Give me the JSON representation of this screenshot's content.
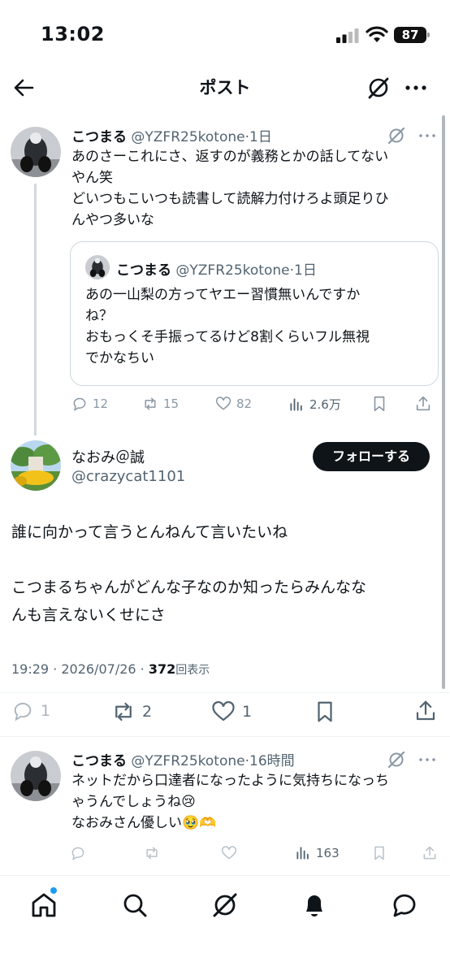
{
  "status_bar": {
    "time": "13:02",
    "battery": "87"
  },
  "header": {
    "title": "ポスト"
  },
  "tweet1": {
    "name": "こつまる",
    "handle": "@YZFR25kotone",
    "time": "1日",
    "lines": [
      "あのさーこれにさ、返すのが義務とかの話してない",
      "やん笑",
      "どいつもこいつも読書して読解力付けろよ頭足りひ",
      "んやつ多いな"
    ],
    "quote": {
      "name": "こつまる",
      "handle": "@YZFR25kotone",
      "time": "1日",
      "lines": [
        "あの一山梨の方ってヤエー習慣無いんですか",
        "ね？",
        "おもっくそ手振ってるけど8割くらいフル無視",
        "でかなちい"
      ]
    },
    "replies": "12",
    "retweets": "15",
    "likes": "82",
    "views": "2.6万"
  },
  "tweet2": {
    "name": "なおみ＠誠",
    "handle": "@crazycat1101",
    "follow_label": "フォローする",
    "lines": [
      "誰に向かって言うとんねんて言いたいね",
      "",
      "こつまるちゃんがどんな子なのか知ったらみんなな",
      "んも言えないくせにさ"
    ],
    "timestamp": "19:29 · 2026/07/26 · ",
    "view_count": "372",
    "view_label": "回表示",
    "replies": "1",
    "retweets": "2",
    "likes": "1"
  },
  "tweet3": {
    "name": "こつまる",
    "handle": "@YZFR25kotone",
    "time": "16時間",
    "lines": [
      "ネットだから口達者になったように気持ちになっち",
      "ゃうんでしょうね😢",
      "なおみさん優しい🥹🫶"
    ],
    "views": "163"
  }
}
